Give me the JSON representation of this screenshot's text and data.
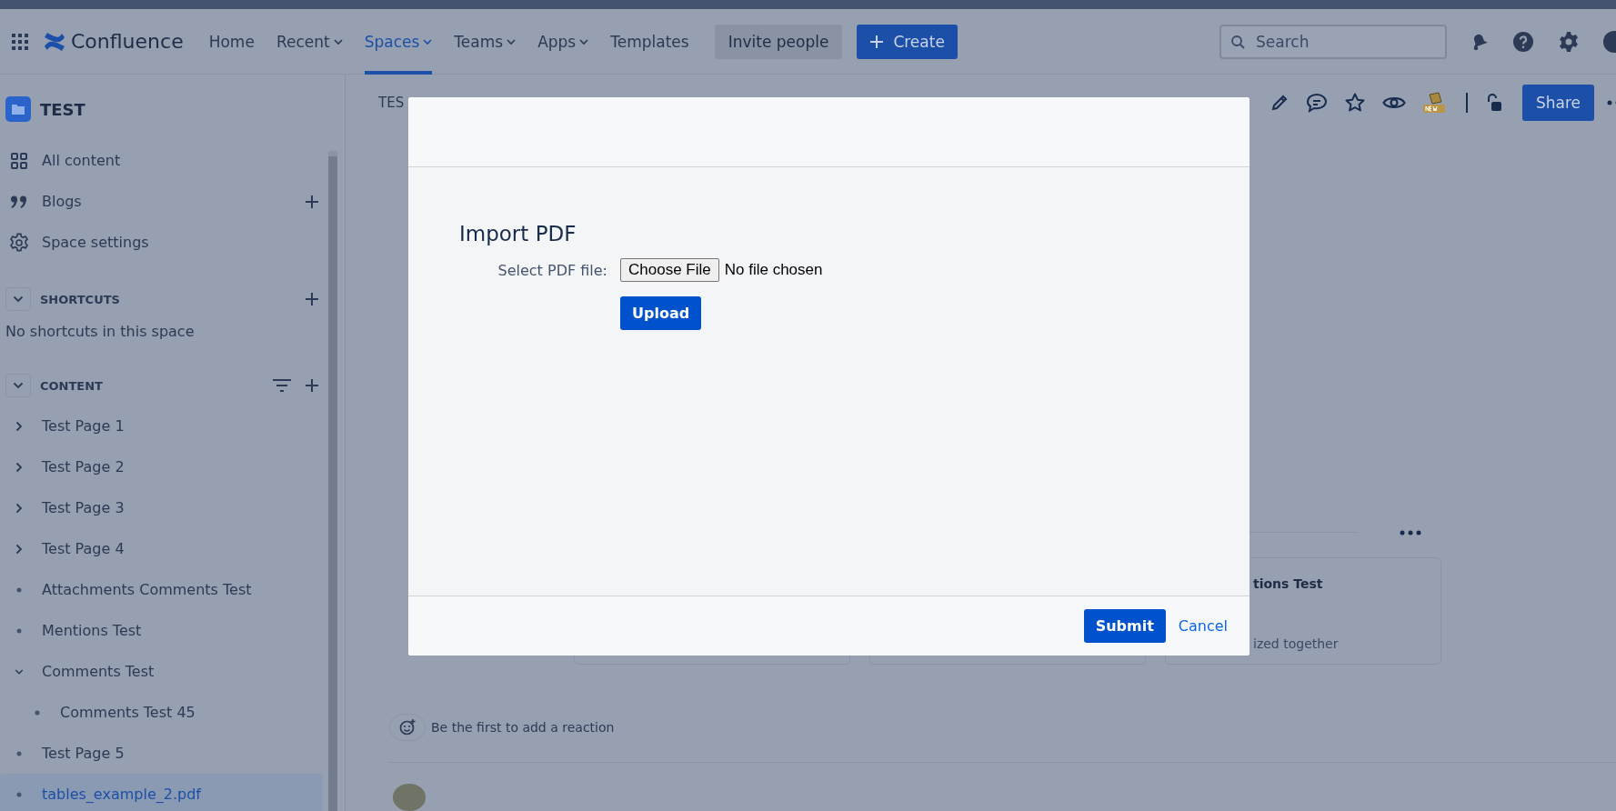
{
  "top_nav": {
    "product": "Confluence",
    "items": [
      {
        "label": "Home",
        "dropdown": false,
        "selected": false
      },
      {
        "label": "Recent",
        "dropdown": true,
        "selected": false
      },
      {
        "label": "Spaces",
        "dropdown": true,
        "selected": true
      },
      {
        "label": "Teams",
        "dropdown": true,
        "selected": false
      },
      {
        "label": "Apps",
        "dropdown": true,
        "selected": false
      },
      {
        "label": "Templates",
        "dropdown": false,
        "selected": false
      }
    ],
    "invite": "Invite people",
    "create": "Create",
    "search": {
      "placeholder": "Search"
    }
  },
  "sidebar": {
    "space": "TEST",
    "links": [
      {
        "label": "All content",
        "add": false
      },
      {
        "label": "Blogs",
        "add": true
      },
      {
        "label": "Space settings",
        "add": false
      }
    ],
    "shortcuts": {
      "heading": "SHORTCUTS",
      "empty": "No shortcuts in this space"
    },
    "content": {
      "heading": "CONTENT",
      "tree": [
        {
          "kind": "branch",
          "label": "Test Page 1",
          "expanded": false,
          "selected": false
        },
        {
          "kind": "branch",
          "label": "Test Page 2",
          "expanded": false,
          "selected": false
        },
        {
          "kind": "branch",
          "label": "Test Page 3",
          "expanded": false,
          "selected": false
        },
        {
          "kind": "branch",
          "label": "Test Page 4",
          "expanded": false,
          "selected": false
        },
        {
          "kind": "leaf",
          "label": "Attachments Comments Test",
          "selected": false
        },
        {
          "kind": "leaf",
          "label": "Mentions Test",
          "selected": false
        },
        {
          "kind": "branch",
          "label": "Comments Test",
          "expanded": true,
          "selected": false,
          "children": [
            {
              "kind": "leaf",
              "label": "Comments Test 45",
              "selected": false
            }
          ]
        },
        {
          "kind": "leaf",
          "label": "Test Page 5",
          "selected": false
        },
        {
          "kind": "leaf",
          "label": "tables_example_2.pdf",
          "selected": true
        }
      ]
    }
  },
  "page": {
    "breadcrumb": "TES",
    "share": "Share",
    "card": {
      "title": "tions Test",
      "excerpt": "ized together"
    },
    "reaction": "Be the first to add a reaction"
  },
  "modal": {
    "title": "Import PDF",
    "field_label": "Select PDF file:",
    "file_button": "Choose File",
    "file_status": "No file chosen",
    "upload": "Upload",
    "submit": "Submit",
    "cancel": "Cancel"
  }
}
